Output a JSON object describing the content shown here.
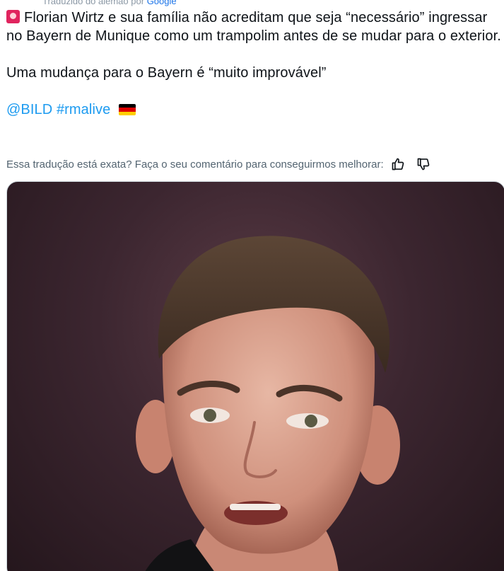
{
  "tweet": {
    "top_label": "Traduzido do alemão por",
    "top_brand": "Google",
    "lines": [
      "Florian Wirtz e sua família não acreditam que seja “necessário” ingressar no Bayern de Munique como um trampolim antes de se mudar para o exterior.",
      "Uma mudança para o Bayern é “muito improvável”"
    ],
    "mention": "@BILD",
    "hashtag": "#rmalive",
    "feedback_question": "Essa tradução está exata? Faça o seu comentário para conseguirmos melhorar:"
  },
  "icons": {
    "siren": "rotating-light-icon",
    "flag": "germany-flag-icon",
    "thumbs_up": "thumbs-up-icon",
    "thumbs_down": "thumbs-down-icon"
  },
  "colors": {
    "link": "#1d9bf0",
    "text": "#0f1419",
    "muted": "#536471"
  }
}
